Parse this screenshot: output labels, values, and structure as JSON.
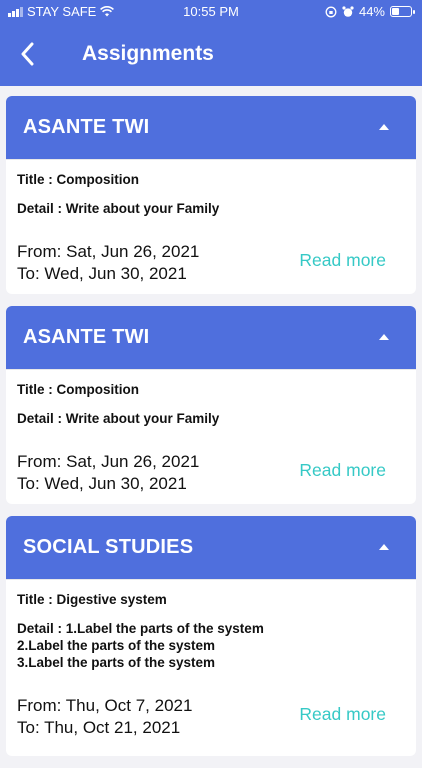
{
  "status_bar": {
    "carrier": "STAY SAFE",
    "time": "10:55 PM",
    "battery": "44%",
    "battery_level": 0.44
  },
  "header": {
    "title": "Assignments"
  },
  "assignments": [
    {
      "subject": "ASANTE TWI",
      "title": "Title : Composition",
      "detail": "Detail : Write about your Family",
      "from": "From: Sat, Jun 26, 2021",
      "to": "To: Wed, Jun 30, 2021",
      "read_more": "Read more"
    },
    {
      "subject": "ASANTE TWI",
      "title": "Title : Composition",
      "detail": "Detail : Write about your Family",
      "from": "From: Sat, Jun 26, 2021",
      "to": "To: Wed, Jun 30, 2021",
      "read_more": "Read more"
    },
    {
      "subject": "SOCIAL STUDIES",
      "title": "Title : Digestive system",
      "detail": "Detail : 1.Label the parts of the system\n2.Label the parts of the system\n3.Label the parts of the system",
      "from": "From: Thu, Oct 7, 2021",
      "to": "To: Thu, Oct 21, 2021",
      "read_more": "Read more"
    }
  ],
  "colors": {
    "primary": "#4f6fdd",
    "link": "#36c9c6",
    "background": "#f2f2f6"
  }
}
